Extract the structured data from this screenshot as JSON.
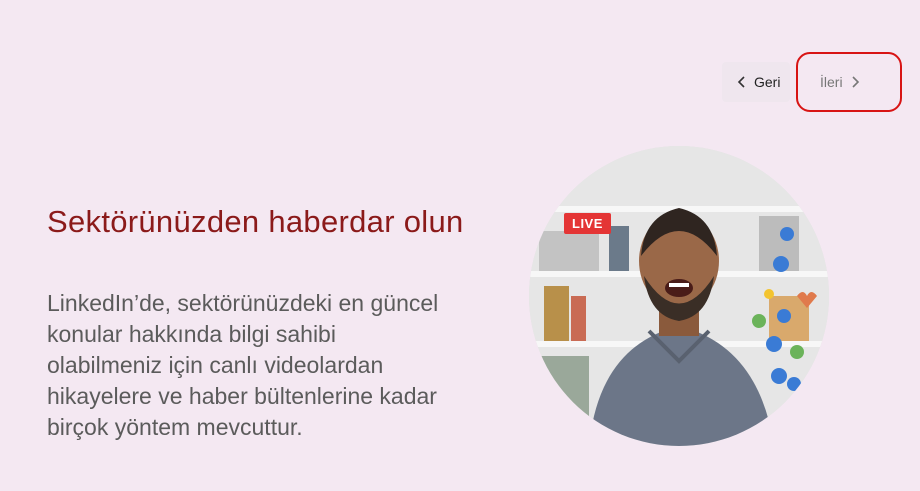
{
  "nav": {
    "back_label": "Geri",
    "next_label": "İleri",
    "highlight_color": "#d81414"
  },
  "content": {
    "headline": "Sektörünüzden haberdar olun",
    "description": "LinkedIn’de, sektörünüzdeki en güncel konular hakkında bilgi sahibi olabilmeniz için canlı videolardan hikayelere ve haber bültenlerine kadar birçok yöntem mevcuttur."
  },
  "media": {
    "live_badge": "LIVE",
    "reaction_icons": [
      "thumbs-up-icon",
      "heart-icon",
      "lightbulb-icon",
      "clap-icon"
    ]
  },
  "colors": {
    "background": "#f4e8f2",
    "headline": "#8b1a1a",
    "body_text": "#5b5b5b",
    "live_red": "#e43535"
  }
}
